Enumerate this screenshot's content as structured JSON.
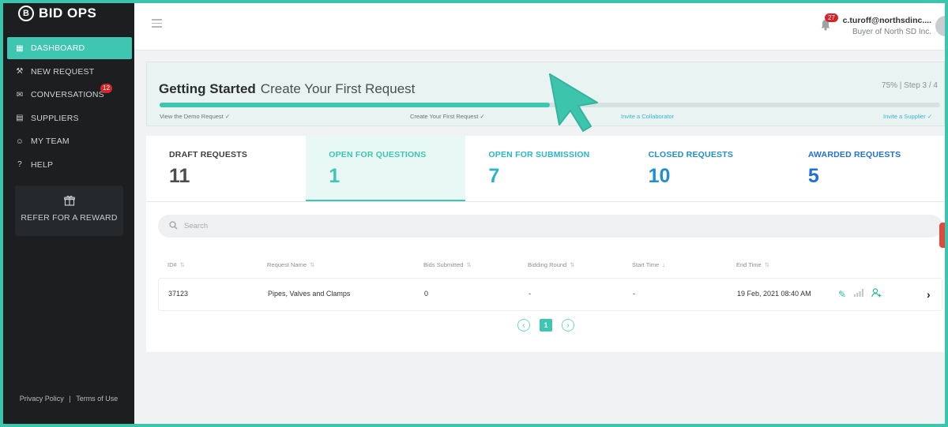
{
  "app": {
    "logo_letter": "B",
    "logo_text": "BID OPS"
  },
  "sidebar": {
    "items": [
      {
        "label": "DASHBOARD",
        "icon": "dashboard-icon",
        "glyph": "▦"
      },
      {
        "label": "NEW REQUEST",
        "icon": "hammer-icon",
        "glyph": "⚒"
      },
      {
        "label": "CONVERSATIONS",
        "icon": "mail-icon",
        "glyph": "✉",
        "badge": "12"
      },
      {
        "label": "SUPPLIERS",
        "icon": "id-card-icon",
        "glyph": "▤"
      },
      {
        "label": "MY TEAM",
        "icon": "team-icon",
        "glyph": "☺"
      },
      {
        "label": "HELP",
        "icon": "help-icon",
        "glyph": "?"
      }
    ],
    "refer": {
      "icon": "gift-icon",
      "glyph": "🎁",
      "label": "REFER FOR A REWARD"
    },
    "footer": {
      "privacy": "Privacy Policy",
      "separator": "|",
      "terms": "Terms of Use"
    }
  },
  "header": {
    "notification_count": "27",
    "user_email": "c.turoff@northsdinc....",
    "user_role": "Buyer of North SD Inc."
  },
  "getting_started": {
    "title": "Getting Started",
    "subtitle": "Create Your First Request",
    "progress_text": "75% | Step 3 / 4",
    "progress": 0.5,
    "steps": [
      "View the Demo Request ✓",
      "Create Your First Request ✓",
      "Invite a Collaborator",
      "Invite a Supplier ✓"
    ]
  },
  "stats": [
    {
      "label": "DRAFT REQUESTS",
      "value": "11",
      "color": "#3a3e42",
      "value_color": "#4a4e52"
    },
    {
      "label": "OPEN FOR QUESTIONS",
      "value": "1",
      "color": "#3ec6b1",
      "value_color": "#3ec6b1"
    },
    {
      "label": "OPEN FOR SUBMISSION",
      "value": "7",
      "color": "#2bb4c8",
      "value_color": "#2bb4c8"
    },
    {
      "label": "CLOSED REQUESTS",
      "value": "10",
      "color": "#1f8fcf",
      "value_color": "#1f8fcf"
    },
    {
      "label": "AWARDED REQUESTS",
      "value": "5",
      "color": "#1f6fd6",
      "value_color": "#1f6fd6"
    }
  ],
  "search": {
    "placeholder": "Search"
  },
  "table": {
    "headers": [
      "ID#",
      "Request Name",
      "Bids Submitted",
      "Bidding Round",
      "Start Time",
      "End Time"
    ],
    "rows": [
      {
        "id": "37123",
        "name": "Pipes, Valves and Clamps",
        "bids": "0",
        "round": "-",
        "start": "-",
        "end": "19 Feb, 2021 08:40 AM"
      }
    ]
  },
  "pagination": {
    "current": "1"
  },
  "colors": {
    "accent": "#3ec6b1",
    "sidebar": "#1c1e20",
    "badge": "#d4262a"
  }
}
